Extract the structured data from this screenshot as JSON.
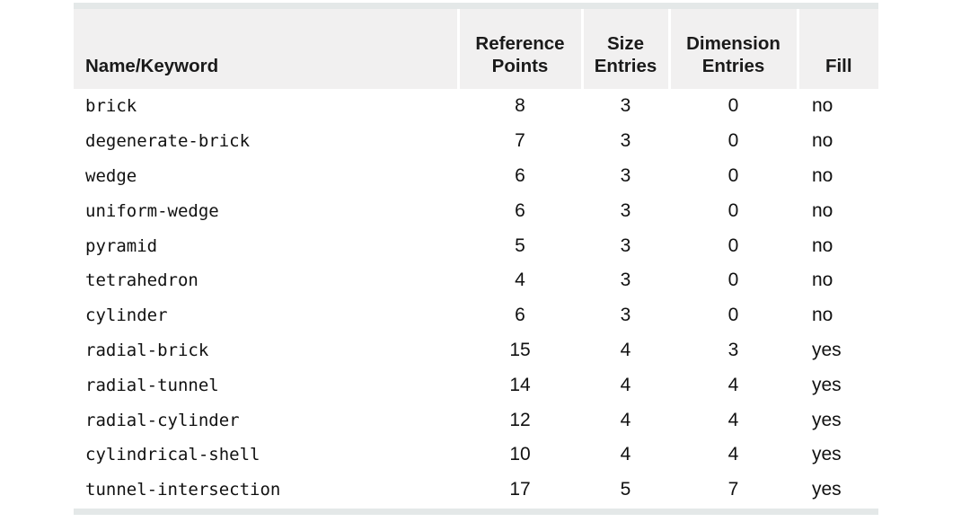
{
  "table": {
    "columns": [
      {
        "key": "name",
        "label_line1": "Name/Keyword",
        "label_line2": ""
      },
      {
        "key": "ref",
        "label_line1": "Reference",
        "label_line2": "Points"
      },
      {
        "key": "size",
        "label_line1": "Size",
        "label_line2": "Entries"
      },
      {
        "key": "dim",
        "label_line1": "Dimension",
        "label_line2": "Entries"
      },
      {
        "key": "fill",
        "label_line1": "Fill",
        "label_line2": ""
      }
    ],
    "rows": [
      {
        "name": "brick",
        "ref": "8",
        "size": "3",
        "dim": "0",
        "fill": "no"
      },
      {
        "name": "degenerate-brick",
        "ref": "7",
        "size": "3",
        "dim": "0",
        "fill": "no"
      },
      {
        "name": "wedge",
        "ref": "6",
        "size": "3",
        "dim": "0",
        "fill": "no"
      },
      {
        "name": "uniform-wedge",
        "ref": "6",
        "size": "3",
        "dim": "0",
        "fill": "no"
      },
      {
        "name": "pyramid",
        "ref": "5",
        "size": "3",
        "dim": "0",
        "fill": "no"
      },
      {
        "name": "tetrahedron",
        "ref": "4",
        "size": "3",
        "dim": "0",
        "fill": "no"
      },
      {
        "name": "cylinder",
        "ref": "6",
        "size": "3",
        "dim": "0",
        "fill": "no"
      },
      {
        "name": "radial-brick",
        "ref": "15",
        "size": "4",
        "dim": "3",
        "fill": "yes"
      },
      {
        "name": "radial-tunnel",
        "ref": "14",
        "size": "4",
        "dim": "4",
        "fill": "yes"
      },
      {
        "name": "radial-cylinder",
        "ref": "12",
        "size": "4",
        "dim": "4",
        "fill": "yes"
      },
      {
        "name": "cylindrical-shell",
        "ref": "10",
        "size": "4",
        "dim": "4",
        "fill": "yes"
      },
      {
        "name": "tunnel-intersection",
        "ref": "17",
        "size": "5",
        "dim": "7",
        "fill": "yes"
      }
    ]
  },
  "colors": {
    "header_background": "#f1f0f0",
    "rule": "#e4e8e8",
    "text": "#111111",
    "page_background": "#ffffff"
  }
}
